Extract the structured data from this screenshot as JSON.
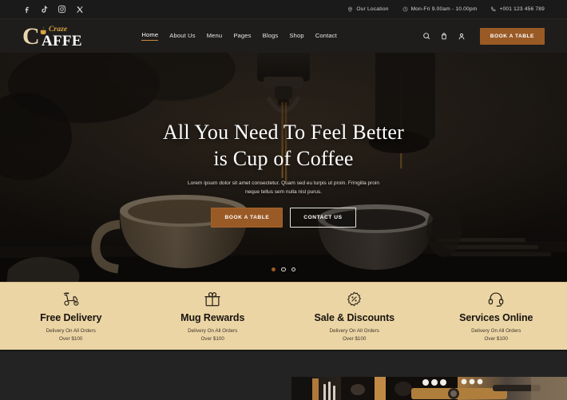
{
  "topbar": {
    "social": [
      {
        "name": "facebook-icon",
        "label": "Facebook"
      },
      {
        "name": "tiktok-icon",
        "label": "TikTok"
      },
      {
        "name": "instagram-icon",
        "label": "Instagram"
      },
      {
        "name": "x-twitter-icon",
        "label": "X"
      }
    ],
    "location": "Our Location",
    "hours": "Mon-Fri 9.00am - 10.00pm",
    "phone": "+001 123 456 789"
  },
  "header": {
    "logo": {
      "letter": "C",
      "script": "Craze",
      "rest": "AFFE"
    },
    "nav": [
      {
        "label": "Home",
        "active": true
      },
      {
        "label": "About Us",
        "active": false
      },
      {
        "label": "Menu",
        "active": false
      },
      {
        "label": "Pages",
        "active": false
      },
      {
        "label": "Blogs",
        "active": false
      },
      {
        "label": "Shop",
        "active": false
      },
      {
        "label": "Contact",
        "active": false
      }
    ],
    "icons": [
      "search-icon",
      "cart-icon",
      "user-icon"
    ],
    "book_button": "BOOK A TABLE"
  },
  "hero": {
    "heading_line1": "All You Need To Feel Better",
    "heading_line2": "is Cup of Coffee",
    "paragraph_line1": "Lorem ipsum dolor sit amet consectetur. Quam sed eu turpis ut",
    "paragraph_line2": "proin. Fringilla proin neque tellus sem nulla nisl purus.",
    "primary_button": "BOOK A TABLE",
    "secondary_button": "CONTACT US",
    "slides": [
      {
        "active": true
      },
      {
        "active": false
      },
      {
        "active": false
      }
    ]
  },
  "features": [
    {
      "icon": "scooter-delivery-icon",
      "title": "Free Delivery",
      "sub_line1": "Delivery On All Orders",
      "sub_line2": "Over $100"
    },
    {
      "icon": "gift-box-icon",
      "title": "Mug Rewards",
      "sub_line1": "Delivery On All Orders",
      "sub_line2": "Over $100"
    },
    {
      "icon": "discount-percent-icon",
      "title": "Sale & Discounts",
      "sub_line1": "Delivery On All Orders",
      "sub_line2": "Over $100"
    },
    {
      "icon": "headset-support-icon",
      "title": "Services Online",
      "sub_line1": "Delivery On All Orders",
      "sub_line2": "Over $100"
    }
  ],
  "colors": {
    "accent_brown": "#9a5a25",
    "accent_gold": "#d9a441",
    "band_tan": "#ecd5a5",
    "dark_bg": "#1d1d1d",
    "header_bg": "#1f1d1b"
  }
}
